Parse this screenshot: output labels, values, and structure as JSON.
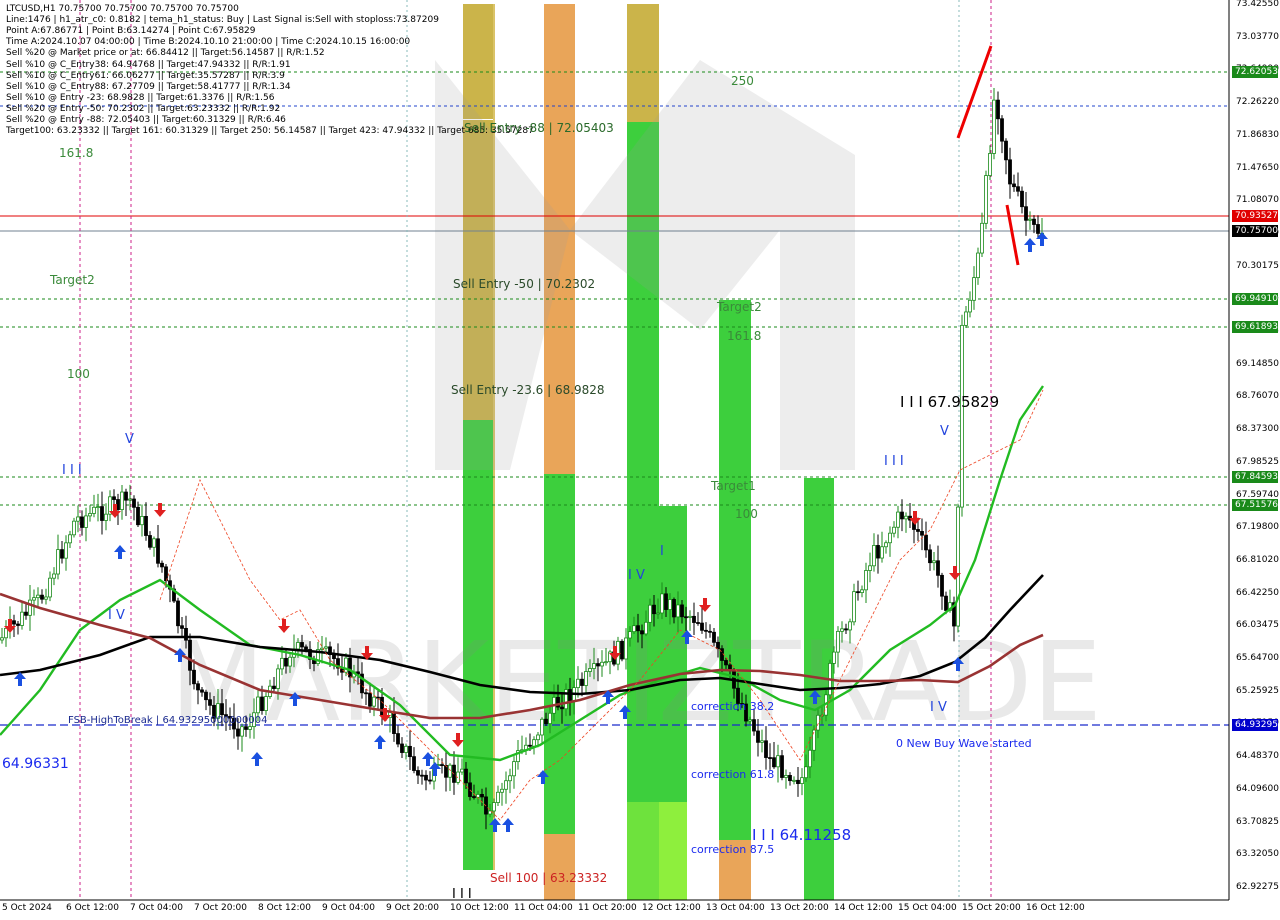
{
  "header": {
    "lines": [
      "LTCUSD,H1  70.75700 70.75700 70.75700 70.75700",
      "Line:1476  |  h1_atr_c0: 0.8182  |  tema_h1_status: Buy  |  Last Signal is:Sell with stoploss:73.87209",
      "Point A:67.86771  |  Point B:63.14274  |  Point C:67.95829",
      "Time A:2024.10.07 04:00:00  |  Time B:2024.10.10 21:00:00  |  Time C:2024.10.15 16:00:00",
      "Sell %20 @ Market price or at: 66.84412  ||  Target:56.14587  ||  R/R:1.52",
      "Sell %10 @ C_Entry38: 64.94768  ||  Target:47.94332  ||  R/R:1.91",
      "Sell %10 @ C_Entry61: 66.06277  ||  Target:35.57287  ||  R/R:3.9",
      "Sell %10 @ C_Entry88: 67.27709  ||  Target:58.41777  ||  R/R:1.34",
      "Sell %10 @ Entry -23: 68.9828  ||  Target:61.3376  ||  R/R:1.56",
      "Sell %20 @ Entry -50: 70.2302  ||  Target:63.23332  ||  R/R:1.92",
      "Sell %20 @ Entry -88: 72.05403  ||  Target:60.31329  ||  R/R:6.46",
      "Target100: 63.23332  ||  Target 161: 60.31329  ||  Target 250: 56.14587  ||  Target 423: 47.94332  ||  Target 685: 35.57287"
    ]
  },
  "price_axis": {
    "ticks": [
      "73.42550",
      "73.03770",
      "72.64990",
      "72.26220",
      "71.86830",
      "71.47650",
      "71.08070",
      "70.69290",
      "70.30175",
      "69.91395",
      "69.53825",
      "69.14850",
      "68.76070",
      "68.37300",
      "67.98525",
      "67.59740",
      "67.19800",
      "66.81020",
      "66.42250",
      "66.03475",
      "65.64700",
      "65.25925",
      "64.87150",
      "64.48370",
      "64.09600",
      "63.70825",
      "63.32050",
      "62.92275"
    ],
    "labels": [
      {
        "text": "72.62053",
        "color": "#1a8a1a"
      },
      {
        "text": "70.93527",
        "color": "#e00000"
      },
      {
        "text": "70.75700",
        "color": "#000000"
      },
      {
        "text": "69.94910",
        "color": "#1a8a1a"
      },
      {
        "text": "69.61893",
        "color": "#1a8a1a"
      },
      {
        "text": "67.84593",
        "color": "#1a8a1a"
      },
      {
        "text": "67.51576",
        "color": "#1a8a1a"
      },
      {
        "text": "64.93295",
        "color": "#0000cc"
      }
    ]
  },
  "time_axis": {
    "ticks": [
      "5 Oct 2024",
      "6 Oct 12:00",
      "7 Oct 04:00",
      "7 Oct 20:00",
      "8 Oct 12:00",
      "9 Oct 04:00",
      "9 Oct 20:00",
      "10 Oct 12:00",
      "11 Oct 04:00",
      "11 Oct 20:00",
      "12 Oct 12:00",
      "13 Oct 04:00",
      "13 Oct 20:00",
      "14 Oct 12:00",
      "15 Oct 04:00",
      "15 Oct 20:00",
      "16 Oct 12:00"
    ]
  },
  "annotations": {
    "sell_entry_88": "Sell Entry -88 | 72.05403",
    "sell_entry_50": "Sell Entry -50 | 70.2302",
    "sell_entry_236": "Sell Entry -23.6 | 68.9828",
    "sell_100": "Sell 100 | 63.23332",
    "fib_250": "250",
    "fib_1618_left": "161.8",
    "target2_left": "Target2",
    "fib_100_left": "100",
    "target2_mid": "Target2",
    "fib_1618_mid": "161.8",
    "target1_mid": "Target1",
    "fib_100_mid": "100",
    "point_c_label": "I I I 67.95829",
    "point_b_label": "I I I 64.11258",
    "wave_v": "V",
    "wave_iii_a": "I I I",
    "wave_iii_b": "I I I",
    "wave_iv_a": "I V",
    "wave_iv_b": "I V",
    "wave_i": "I",
    "wave_v_b": "V",
    "wave_i_bottom": "I I I",
    "correction_382": "correction 38.2",
    "correction_618": "correction 61.8",
    "correction_875": "correction 87.5",
    "fsb": "FSB-HighToBreak | 64.93295000000004",
    "new_buy_wave": "0 New Buy Wave started",
    "left_price": "64.96331",
    "watermark": "MARKETIZTRADE"
  },
  "colors": {
    "bull": "#1a8a1a",
    "bear": "#000000",
    "sma_green": "#22bb22",
    "sma_black": "#000000",
    "sma_brown": "#993333",
    "fib_orange": "#e8a050",
    "fib_green": "#33cc33",
    "fib_olive": "#c8b040",
    "buy_arrow": "#1a50e0",
    "sell_arrow": "#e02020"
  }
}
